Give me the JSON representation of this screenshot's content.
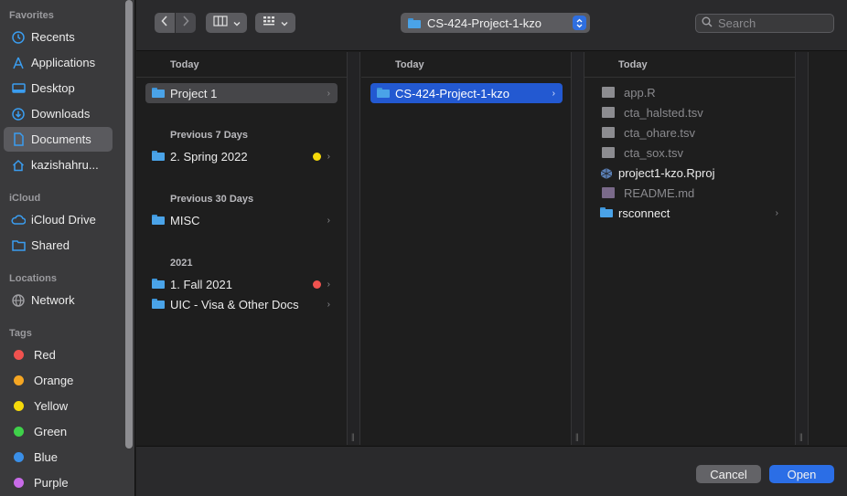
{
  "sidebar": {
    "favorites_header": "Favorites",
    "favorites": [
      {
        "label": "Recents",
        "icon": "clock-icon"
      },
      {
        "label": "Applications",
        "icon": "applications-icon"
      },
      {
        "label": "Desktop",
        "icon": "desktop-icon"
      },
      {
        "label": "Downloads",
        "icon": "download-icon"
      },
      {
        "label": "Documents",
        "icon": "document-icon",
        "selected": true
      },
      {
        "label": "kazishahru...",
        "icon": "home-icon"
      }
    ],
    "icloud_header": "iCloud",
    "icloud": [
      {
        "label": "iCloud Drive",
        "icon": "cloud-icon"
      },
      {
        "label": "Shared",
        "icon": "shared-folder-icon"
      }
    ],
    "locations_header": "Locations",
    "locations": [
      {
        "label": "Network",
        "icon": "network-icon"
      }
    ],
    "tags_header": "Tags",
    "tags": [
      {
        "label": "Red",
        "color": "#f0524f"
      },
      {
        "label": "Orange",
        "color": "#f5a623"
      },
      {
        "label": "Yellow",
        "color": "#f5d90a"
      },
      {
        "label": "Green",
        "color": "#3fd14a"
      },
      {
        "label": "Blue",
        "color": "#3a8fe8"
      },
      {
        "label": "Purple",
        "color": "#c86be8"
      }
    ]
  },
  "toolbar": {
    "path": "CS-424-Project-1-kzo",
    "search_placeholder": "Search"
  },
  "column1": {
    "header": "Today",
    "groups": [
      {
        "header": "",
        "items": [
          {
            "label": "Project 1",
            "selected": true
          }
        ]
      },
      {
        "header": "Previous 7 Days",
        "items": [
          {
            "label": "2. Spring 2022",
            "tag": "#f5d90a"
          }
        ]
      },
      {
        "header": "Previous 30 Days",
        "items": [
          {
            "label": "MISC"
          }
        ]
      },
      {
        "header": "2021",
        "items": [
          {
            "label": "1. Fall 2021",
            "tag": "#f0524f"
          },
          {
            "label": "UIC - Visa & Other Docs"
          }
        ]
      }
    ]
  },
  "column2": {
    "header": "Today",
    "items": [
      {
        "label": "CS-424-Project-1-kzo",
        "selected": true
      }
    ]
  },
  "column3": {
    "header": "Today",
    "items": [
      {
        "label": "app.R",
        "kind": "doc",
        "dim": true
      },
      {
        "label": "cta_halsted.tsv",
        "kind": "doc",
        "dim": true
      },
      {
        "label": "cta_ohare.tsv",
        "kind": "doc",
        "dim": true
      },
      {
        "label": "cta_sox.tsv",
        "kind": "doc",
        "dim": true
      },
      {
        "label": "project1-kzo.Rproj",
        "kind": "rproj",
        "dim": false
      },
      {
        "label": "README.md",
        "kind": "md",
        "dim": true
      },
      {
        "label": "rsconnect",
        "kind": "folder",
        "dim": false
      }
    ]
  },
  "buttons": {
    "cancel": "Cancel",
    "open": "Open"
  }
}
